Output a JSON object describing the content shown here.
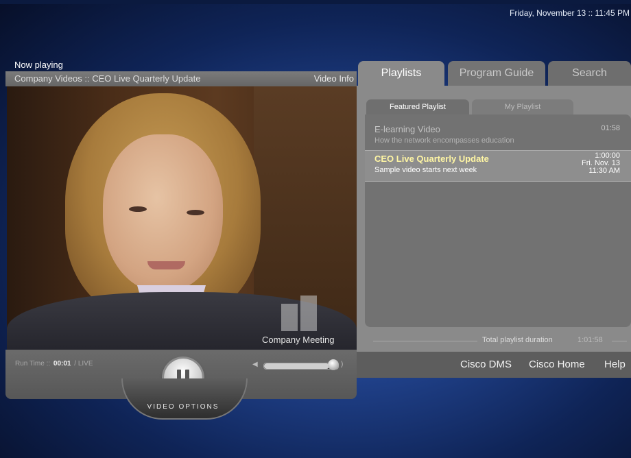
{
  "datetime": "Friday, November 13 :: 11:45 PM",
  "player": {
    "now_playing_label": "Now playing",
    "title": "Company Videos :: CEO Live Quarterly Update",
    "video_info_label": "Video Info",
    "watermark": "Company Meeting",
    "run_time_label": "Run Time ::",
    "run_time_value": "00:01",
    "run_time_suffix": "/ LIVE",
    "volume_fraction": 0.88,
    "video_options_label": "VIDEO OPTIONS"
  },
  "tabs": [
    {
      "label": "Playlists",
      "active": true
    },
    {
      "label": "Program Guide",
      "active": false
    },
    {
      "label": "Search",
      "active": false
    }
  ],
  "subtabs": [
    {
      "label": "Featured Playlist",
      "active": true
    },
    {
      "label": "My Playlist",
      "active": false
    }
  ],
  "playlist": [
    {
      "title": "E-learning Video",
      "description": "How the network encompasses education",
      "duration": "01:58",
      "date": "",
      "time": ""
    },
    {
      "title": "CEO Live Quarterly Update",
      "description": "Sample video starts next week",
      "duration": "1:00:00",
      "date": "Fri. Nov. 13",
      "time": "11:30 AM"
    }
  ],
  "total_duration_label": "Total playlist duration",
  "total_duration_value": "1:01:58",
  "footer_links": [
    "Cisco DMS",
    "Cisco Home",
    "Help"
  ],
  "icons": {
    "pause": "pause-icon",
    "volume": "volume-icon"
  }
}
